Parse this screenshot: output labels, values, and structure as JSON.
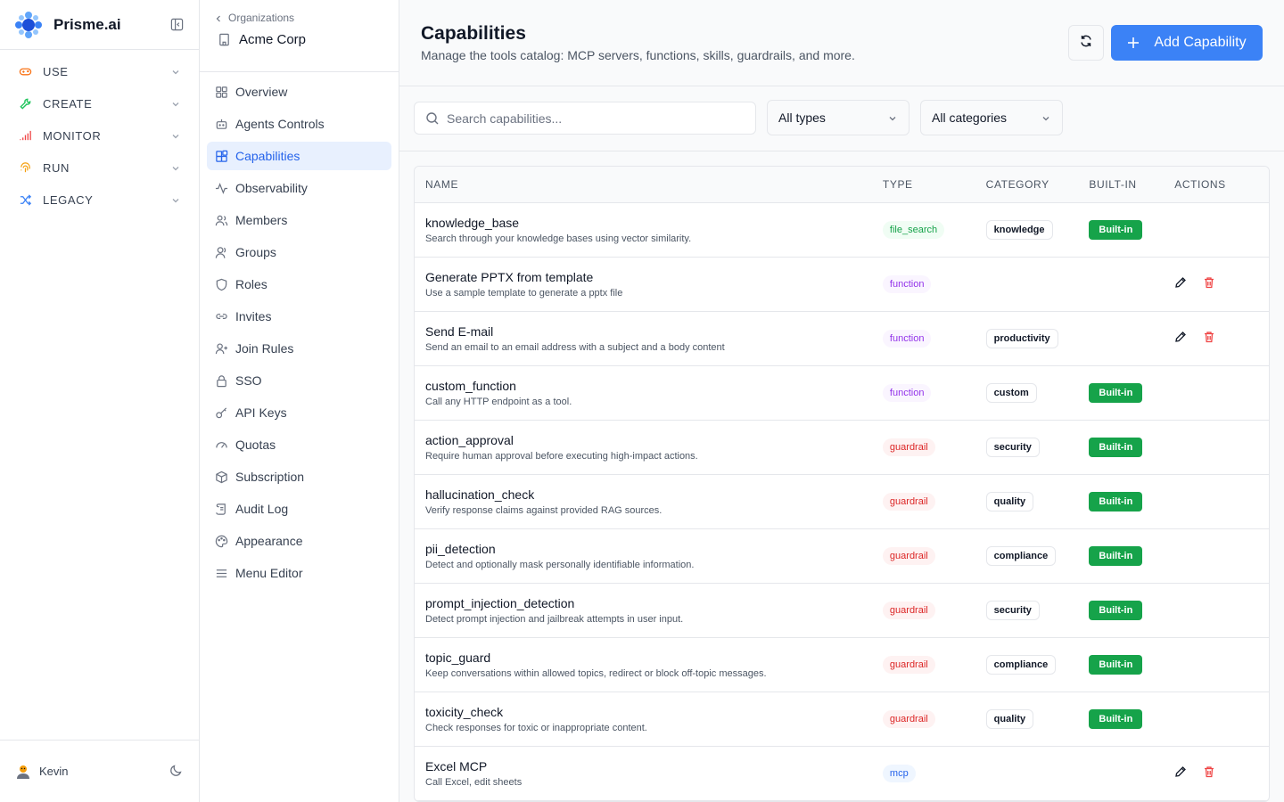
{
  "brand": {
    "name": "Prisme.ai"
  },
  "nav": {
    "sections": [
      {
        "label": "USE",
        "icon": "gamepad-icon",
        "color": "#f97316"
      },
      {
        "label": "CREATE",
        "icon": "wrench-icon",
        "color": "#22c55e"
      },
      {
        "label": "MONITOR",
        "icon": "signal-bars-icon",
        "color": "#ef4444"
      },
      {
        "label": "RUN",
        "icon": "fingerprint-icon",
        "color": "#f59e0b"
      },
      {
        "label": "LEGACY",
        "icon": "shuffle-icon",
        "color": "#3b82f6"
      }
    ]
  },
  "user": {
    "name": "Kevin"
  },
  "org": {
    "breadcrumb": "Organizations",
    "name": "Acme Corp",
    "menu": [
      {
        "label": "Overview",
        "icon": "grid-icon"
      },
      {
        "label": "Agents Controls",
        "icon": "bot-icon"
      },
      {
        "label": "Capabilities",
        "icon": "blocks-icon",
        "active": true
      },
      {
        "label": "Observability",
        "icon": "activity-icon"
      },
      {
        "label": "Members",
        "icon": "users-icon"
      },
      {
        "label": "Groups",
        "icon": "user-group-icon"
      },
      {
        "label": "Roles",
        "icon": "shield-icon"
      },
      {
        "label": "Invites",
        "icon": "link-icon"
      },
      {
        "label": "Join Rules",
        "icon": "user-plus-icon"
      },
      {
        "label": "SSO",
        "icon": "lock-icon"
      },
      {
        "label": "API Keys",
        "icon": "key-icon"
      },
      {
        "label": "Quotas",
        "icon": "gauge-icon"
      },
      {
        "label": "Subscription",
        "icon": "package-icon"
      },
      {
        "label": "Audit Log",
        "icon": "scroll-icon"
      },
      {
        "label": "Appearance",
        "icon": "palette-icon"
      },
      {
        "label": "Menu Editor",
        "icon": "menu-icon"
      }
    ]
  },
  "page": {
    "title": "Capabilities",
    "subtitle": "Manage the tools catalog: MCP servers, functions, skills, guardrails, and more.",
    "add_label": "Add Capability"
  },
  "filters": {
    "search_placeholder": "Search capabilities...",
    "type_value": "All types",
    "category_value": "All categories"
  },
  "table": {
    "headers": {
      "name": "NAME",
      "type": "TYPE",
      "category": "CATEGORY",
      "builtin": "BUILT-IN",
      "actions": "ACTIONS"
    },
    "rows": [
      {
        "name": "knowledge_base",
        "desc": "Search through your knowledge bases using vector similarity.",
        "type": "file_search",
        "category": "knowledge",
        "builtin": "Built-in",
        "editable": false
      },
      {
        "name": "Generate PPTX from template",
        "desc": "Use a sample template to generate a pptx file",
        "type": "function",
        "category": "",
        "builtin": "",
        "editable": true
      },
      {
        "name": "Send E-mail",
        "desc": "Send an email to an email address with a subject and a body content",
        "type": "function",
        "category": "productivity",
        "builtin": "",
        "editable": true
      },
      {
        "name": "custom_function",
        "desc": "Call any HTTP endpoint as a tool.",
        "type": "function",
        "category": "custom",
        "builtin": "Built-in",
        "editable": false
      },
      {
        "name": "action_approval",
        "desc": "Require human approval before executing high-impact actions.",
        "type": "guardrail",
        "category": "security",
        "builtin": "Built-in",
        "editable": false
      },
      {
        "name": "hallucination_check",
        "desc": "Verify response claims against provided RAG sources.",
        "type": "guardrail",
        "category": "quality",
        "builtin": "Built-in",
        "editable": false
      },
      {
        "name": "pii_detection",
        "desc": "Detect and optionally mask personally identifiable information.",
        "type": "guardrail",
        "category": "compliance",
        "builtin": "Built-in",
        "editable": false
      },
      {
        "name": "prompt_injection_detection",
        "desc": "Detect prompt injection and jailbreak attempts in user input.",
        "type": "guardrail",
        "category": "security",
        "builtin": "Built-in",
        "editable": false
      },
      {
        "name": "topic_guard",
        "desc": "Keep conversations within allowed topics, redirect or block off-topic messages.",
        "type": "guardrail",
        "category": "compliance",
        "builtin": "Built-in",
        "editable": false
      },
      {
        "name": "toxicity_check",
        "desc": "Check responses for toxic or inappropriate content.",
        "type": "guardrail",
        "category": "quality",
        "builtin": "Built-in",
        "editable": false
      },
      {
        "name": "Excel MCP",
        "desc": "Call Excel, edit sheets",
        "type": "mcp",
        "category": "",
        "builtin": "",
        "editable": true
      }
    ]
  },
  "colors": {
    "accent": "#3b82f6",
    "builtin": "#16a34a",
    "delete": "#ef4444"
  }
}
